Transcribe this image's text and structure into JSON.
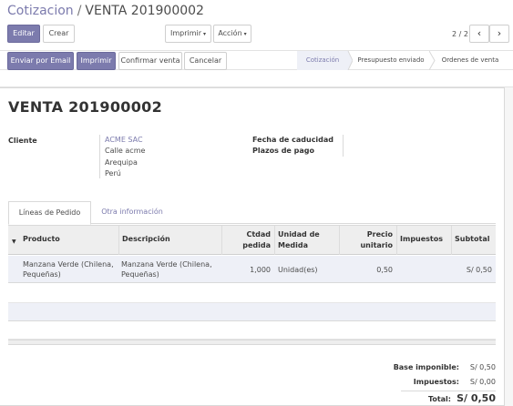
{
  "breadcrumb": {
    "parent": "Cotizacion",
    "separator": "/",
    "current": "VENTA 201900002"
  },
  "toolbar": {
    "edit_label": "Editar",
    "create_label": "Crear",
    "print_label": "Imprimir",
    "action_label": "Acción",
    "caret": "▾"
  },
  "pager": {
    "value": "2 / 2",
    "prev_icon": "‹",
    "next_icon": "›"
  },
  "header_buttons": {
    "send_email": "Enviar por Email",
    "print": "Imprimir",
    "confirm": "Confirmar venta",
    "cancel": "Cancelar"
  },
  "stages": [
    {
      "label": "Cotización",
      "active": true
    },
    {
      "label": "Presupuesto enviado",
      "active": false
    },
    {
      "label": "Ordenes de venta",
      "active": false
    }
  ],
  "record": {
    "title": "VENTA 201900002",
    "customer_label": "Cliente",
    "customer_name": "ACME SAC",
    "address_lines": [
      "Calle acme",
      "Arequipa",
      "Perú"
    ],
    "expiry_label": "Fecha de caducidad",
    "payment_terms_label": "Plazos de pago"
  },
  "tabs": [
    {
      "label": "Líneas de Pedido",
      "active": true
    },
    {
      "label": "Otra información",
      "active": false
    }
  ],
  "grid": {
    "sort_icon": "▼",
    "columns": [
      {
        "label": "Producto"
      },
      {
        "label": "Descripción"
      },
      {
        "label": "Ctdad pedida"
      },
      {
        "label": "Unidad de Medida"
      },
      {
        "label": "Precio unitario"
      },
      {
        "label": "Impuestos"
      },
      {
        "label": "Subtotal"
      }
    ],
    "rows": [
      {
        "product": "Manzana Verde (Chilena, Pequeñas)",
        "description": "Manzana Verde (Chilena, Pequeñas)",
        "qty": "1,000",
        "uom": "Unidad(es)",
        "price": "0,50",
        "taxes": "",
        "subtotal": "S/ 0,50"
      }
    ]
  },
  "totals": {
    "untaxed_label": "Base imponible:",
    "untaxed_value": "S/ 0,50",
    "taxes_label": "Impuestos:",
    "taxes_value": "S/ 0,00",
    "total_label": "Total:",
    "total_value": "S/ 0,50"
  },
  "colors": {
    "accent": "#7c7bad",
    "stage_active_bg": "#eef0f7",
    "grid_header_bg": "#eeeeee",
    "row_selected_bg": "#eef0f7"
  }
}
